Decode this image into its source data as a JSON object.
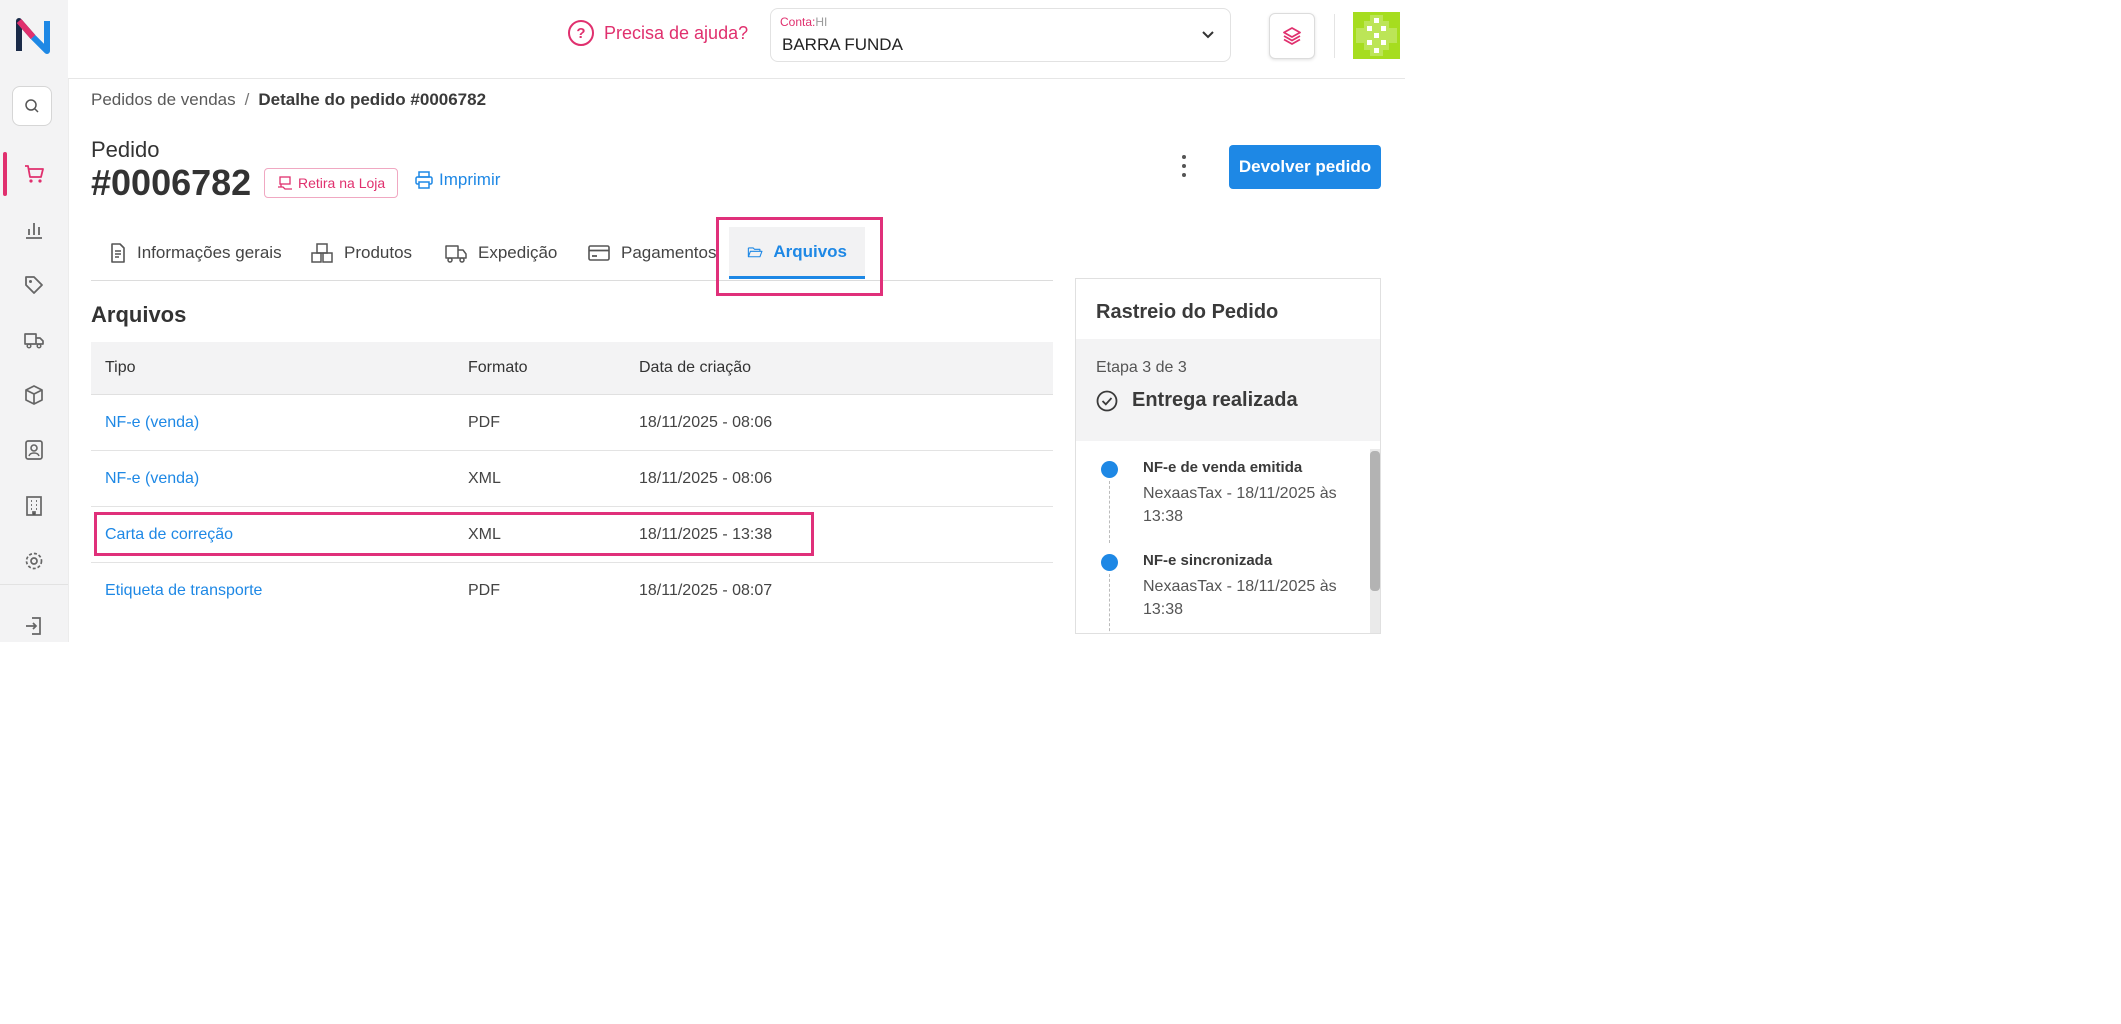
{
  "help": {
    "label": "Precisa de ajuda?"
  },
  "account": {
    "label": "Conta:",
    "code": "HI",
    "value": "BARRA FUNDA"
  },
  "breadcrumb": {
    "parent": "Pedidos de vendas",
    "separator": "/",
    "current": "Detalhe do pedido #0006782"
  },
  "order": {
    "label": "Pedido",
    "number": "#0006782",
    "badge": "Retira na Loja",
    "print": "Imprimir"
  },
  "actions": {
    "return_label": "Devolver pedido"
  },
  "tabs": [
    {
      "label": "Informações gerais"
    },
    {
      "label": "Produtos"
    },
    {
      "label": "Expedição"
    },
    {
      "label": "Pagamentos"
    },
    {
      "label": "Arquivos"
    }
  ],
  "files": {
    "title": "Arquivos",
    "headers": [
      "Tipo",
      "Formato",
      "Data de criação"
    ],
    "rows": [
      {
        "type": "NF-e (venda)",
        "format": "PDF",
        "date": "18/11/2025 - 08:06"
      },
      {
        "type": "NF-e (venda)",
        "format": "XML",
        "date": "18/11/2025 - 08:06"
      },
      {
        "type": "Carta de correção",
        "format": "XML",
        "date": "18/11/2025 - 13:38"
      },
      {
        "type": "Etiqueta de transporte",
        "format": "PDF",
        "date": "18/11/2025 - 08:07"
      }
    ]
  },
  "tracking": {
    "title": "Rastreio do Pedido",
    "step": "Etapa 3 de 3",
    "status": "Entrega realizada",
    "events": [
      {
        "title": "NF-e de venda emitida",
        "detail": "NexaasTax - 18/11/2025 às 13:38"
      },
      {
        "title": "NF-e sincronizada",
        "detail": "NexaasTax - 18/11/2025 às 13:38"
      }
    ]
  },
  "colors": {
    "accent": "#1e88e5",
    "brand": "#e0306e",
    "highlight": "#e0307a"
  }
}
